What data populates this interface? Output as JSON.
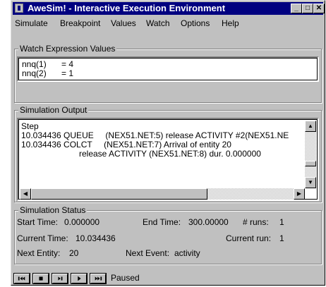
{
  "window": {
    "title": "AweSim! - Interactive Execution Environment",
    "minimize_label": "_",
    "maximize_label": "□",
    "close_label": "✕"
  },
  "menu": [
    "Simulate",
    "Breakpoint",
    "Values",
    "Watch",
    "Options",
    "Help"
  ],
  "watch": {
    "label": "Watch Expression Values",
    "rows": [
      {
        "name": "nnq(1)",
        "value": "= 4"
      },
      {
        "name": "nnq(2)",
        "value": "= 1"
      }
    ]
  },
  "output": {
    "label": "Simulation Output",
    "lines": [
      "Step",
      "10.034436 QUEUE     (NEX51.NET:5) release ACTIVITY #2(NEX51.NE",
      "10.034436 COLCT     (NEX51.NET:7) Arrival of entity 20",
      "release ACTIVITY (NEX51.NET:8) dur. 0.000000"
    ]
  },
  "status": {
    "label": "Simulation Status",
    "start_time_label": "Start Time:",
    "start_time": "0.000000",
    "end_time_label": "End Time:",
    "end_time": "300.00000",
    "runs_label": "# runs:",
    "runs": "1",
    "current_time_label": "Current Time:",
    "current_time": "10.034436",
    "current_run_label": "Current run:",
    "current_run": "1",
    "next_entity_label": "Next Entity:",
    "next_entity": "20",
    "next_event_label": "Next Event:",
    "next_event": "activity"
  },
  "toolbar": {
    "state": "Paused",
    "buttons": [
      "rewind-to-start-icon",
      "stop-icon",
      "step-icon",
      "play-icon",
      "fast-forward-icon"
    ]
  },
  "colors": {
    "titlebar": "#000080",
    "face": "#c0c0c0"
  }
}
